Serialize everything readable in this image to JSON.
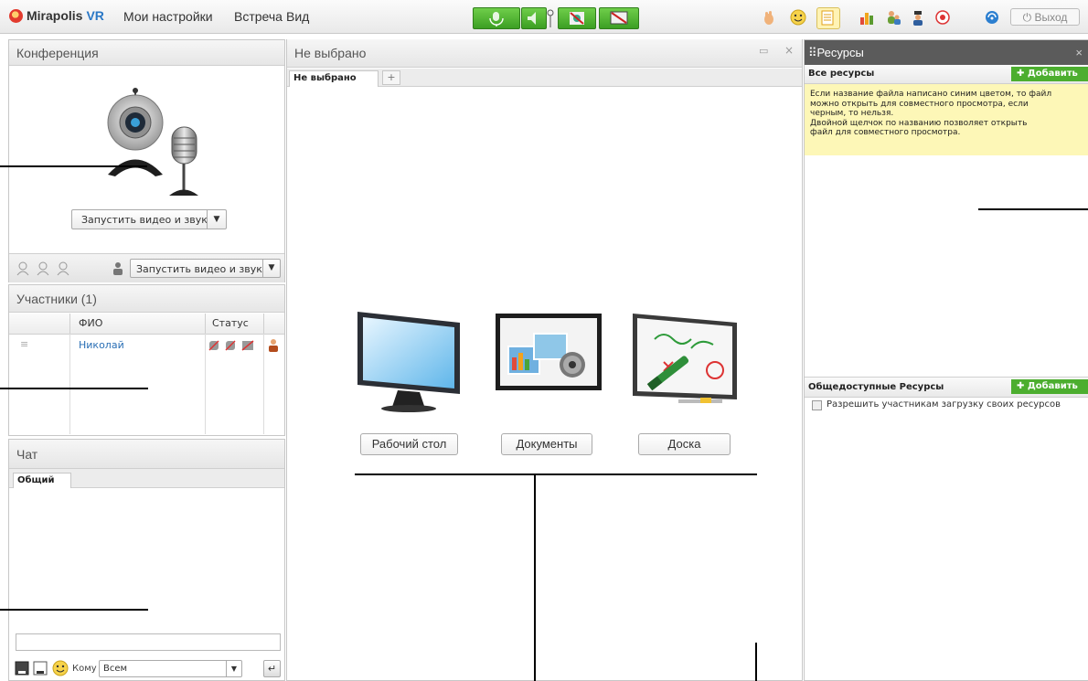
{
  "app": {
    "logo_text": "Mirapolis",
    "logo_suffix": "VR"
  },
  "menu": [
    "Мои настройки",
    "Встреча",
    "Вид"
  ],
  "toolbar": {
    "exit_label": "Выход",
    "exit_icon": "power-icon"
  },
  "conference": {
    "title": "Конференция",
    "start_av_label": "Запустить видео и звук",
    "start_av_label_2": "Запустить видео и звук"
  },
  "participants": {
    "title": "Участники (1)",
    "columns": [
      "",
      "ФИО",
      "Статус",
      ""
    ],
    "rows": [
      {
        "name": "Николай"
      }
    ]
  },
  "chat": {
    "title": "Чат",
    "tab": "Общий",
    "to_label": "Кому",
    "to_value": "Всем",
    "input_value": ""
  },
  "center": {
    "title": "Не выбрано",
    "tab_label": "Не выбрано",
    "add_tab": "+",
    "options": [
      "Рабочий стол",
      "Документы",
      "Доска"
    ]
  },
  "resources": {
    "title": "Ресурсы",
    "all_title": "Все ресурсы",
    "add_label": "Добавить",
    "hint_lines": [
      "Если название файла написано синим цветом, то файл",
      "можно открыть для совместного просмотра, если",
      "черным, то нельзя.",
      "Двойной щелчок по названию позволяет открыть",
      "файл для совместного просмотра."
    ],
    "public_title": "Общедоступные Ресурсы",
    "public_add_label": "Добавить",
    "allow_upload_label": "Разрешить участникам загрузку своих ресурсов"
  },
  "colors": {
    "accent_green": "#4cae2f",
    "link_blue": "#2a6fb5",
    "hint_bg": "#fdf7b7",
    "resource_header": "#5b5b5b"
  }
}
